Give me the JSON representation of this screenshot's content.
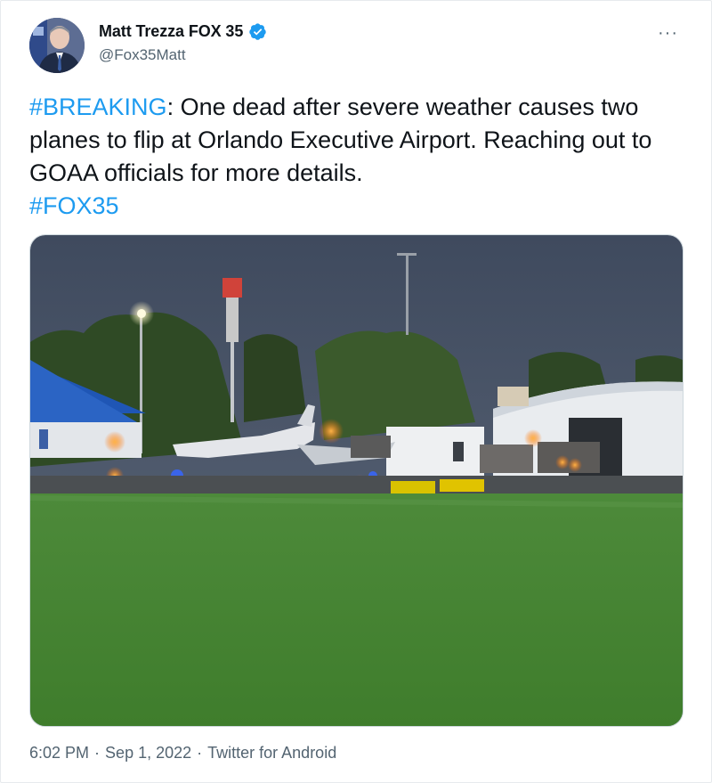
{
  "author": {
    "display_name": "Matt Trezza FOX 35",
    "handle": "@Fox35Matt",
    "verified": true,
    "avatar_icon": "person-avatar-icon",
    "verified_icon": "verified-badge-icon"
  },
  "more_menu": {
    "label": "···",
    "icon": "more-options-icon"
  },
  "tweet": {
    "hashtag_breaking": "#BREAKING",
    "body": ": One dead after severe weather causes two planes to flip at Orlando Executive Airport. Reaching out to GOAA officials for more details.",
    "hashtag_fox": "#FOX35"
  },
  "footer": {
    "time": "6:02 PM",
    "sep1": "·",
    "date": "Sep 1, 2022",
    "sep2": "·",
    "source": "Twitter for Android"
  },
  "colors": {
    "link": "#1d9bf0",
    "text": "#0f1419",
    "muted": "#536471",
    "verified": "#1d9bf0"
  }
}
